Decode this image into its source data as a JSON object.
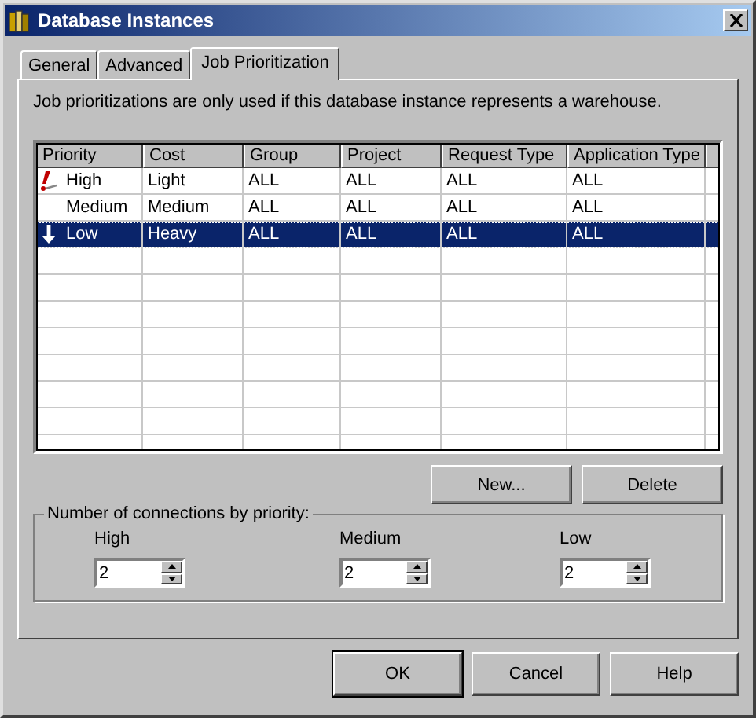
{
  "window": {
    "title": "Database Instances"
  },
  "tabs": [
    {
      "label": "General",
      "selected": false
    },
    {
      "label": "Advanced",
      "selected": false
    },
    {
      "label": "Job Prioritization",
      "selected": true
    }
  ],
  "note": "Job prioritizations are only used if this database instance represents a warehouse.",
  "table": {
    "columns": [
      "Priority",
      "Cost",
      "Group",
      "Project",
      "Request Type",
      "Application Type"
    ],
    "rows": [
      {
        "kind": "high",
        "selected": false,
        "cells": [
          "High",
          "Light",
          "ALL",
          "ALL",
          "ALL",
          "ALL"
        ]
      },
      {
        "kind": "plain",
        "selected": false,
        "cells": [
          "Medium",
          "Medium",
          "ALL",
          "ALL",
          "ALL",
          "ALL"
        ]
      },
      {
        "kind": "low",
        "selected": true,
        "cells": [
          "Low",
          "Heavy",
          "ALL",
          "ALL",
          "ALL",
          "ALL"
        ]
      }
    ]
  },
  "table_buttons": [
    "New...",
    "Delete"
  ],
  "connections": {
    "title": "Number of connections by priority:",
    "fields": [
      {
        "label": "High",
        "value": "2"
      },
      {
        "label": "Medium",
        "value": "2"
      },
      {
        "label": "Low",
        "value": "2"
      }
    ]
  },
  "buttons": [
    {
      "label": "OK",
      "default": true
    },
    {
      "label": "Cancel",
      "default": false
    },
    {
      "label": "Help",
      "default": false
    }
  ]
}
